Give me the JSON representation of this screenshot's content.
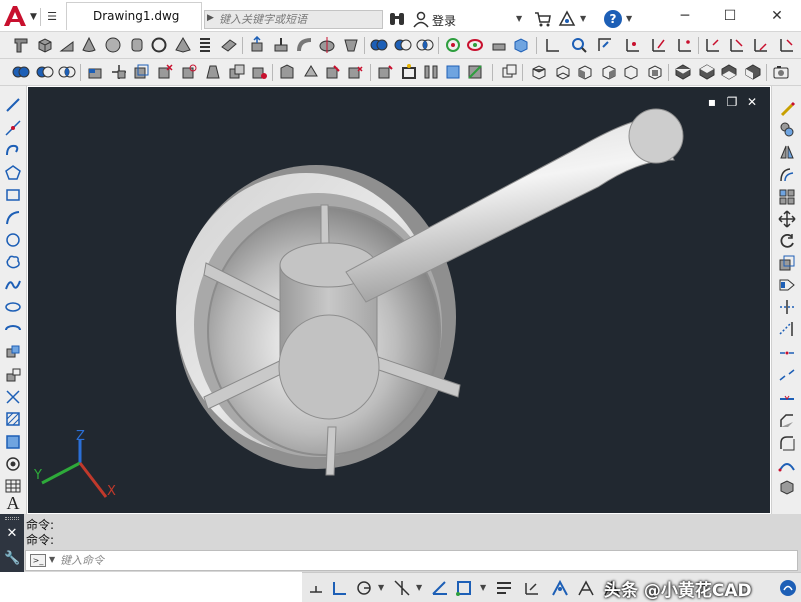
{
  "title_bar": {
    "document_tab": "Drawing1.dwg",
    "search_placeholder": "键入关键字或短语",
    "login_label": "登录",
    "help_label": "?",
    "window_controls": {
      "minimize": "─",
      "maximize": "☐",
      "close": "✕"
    }
  },
  "viewport": {
    "controls": {
      "minimize": "▪",
      "restore": "❐",
      "close": "✕"
    },
    "ucs_axes": {
      "x": "X",
      "y": "Y",
      "z": "Z"
    },
    "background_color": "#212830",
    "model_color": "#d8d8d8"
  },
  "command": {
    "history": [
      "命令:",
      "命令:"
    ],
    "input_placeholder": "键入命令"
  },
  "left_toolbar": {
    "text_tool_label": "A"
  },
  "status_bar": {
    "watermark": "头条 @小黄花CAD"
  },
  "colors": {
    "brand_red": "#c8102e",
    "accent_blue": "#1d5fb6",
    "panel_gray": "#eeeeee",
    "command_gray": "#d7d7d7"
  }
}
